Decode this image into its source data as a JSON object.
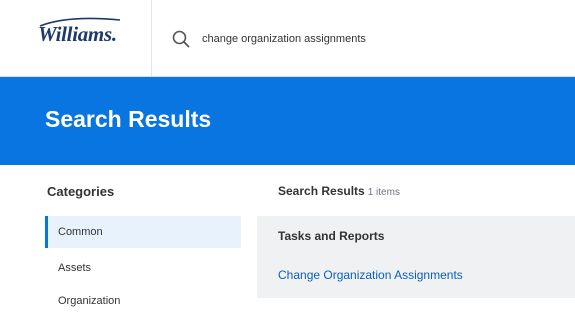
{
  "header": {
    "logo_text": "Williams.",
    "search": {
      "icon": "search-icon",
      "value": "change organization assignments"
    }
  },
  "banner": {
    "title": "Search Results"
  },
  "sidebar": {
    "heading": "Categories",
    "items": [
      {
        "label": "Common",
        "active": true
      },
      {
        "label": "Assets",
        "active": false
      },
      {
        "label": "Organization",
        "active": false
      }
    ]
  },
  "results": {
    "heading": "Search Results",
    "count": "1 items",
    "groups": [
      {
        "title": "Tasks and Reports",
        "items": [
          {
            "label": "Change Organization Assignments"
          }
        ]
      }
    ]
  },
  "colors": {
    "accent": "#0875e1",
    "link": "#0b5fbf",
    "logo": "#1d3a6e",
    "panel_bg": "#f0f1f2",
    "active_item_bg": "#e8f2fc"
  }
}
